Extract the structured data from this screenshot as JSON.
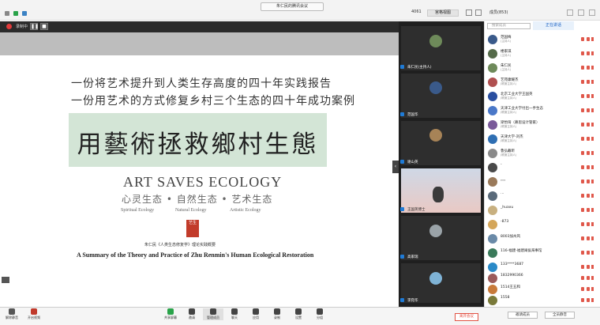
{
  "topbar": {
    "meeting_title": "朱仁民的腾讯会议",
    "meeting_id": "4061",
    "view_mode": "宫格视图",
    "member_panel_label": "成员(853)"
  },
  "recording": {
    "label": "录制中"
  },
  "slide": {
    "line1": "一份将艺术提升到人类生存高度的四十年实践报告",
    "line2": "一份用艺术的方式修复乡村三个生态的四十年成功案例",
    "title_cn": "用藝術拯救鄉村生態",
    "title_en": "ART SAVES ECOLOGY",
    "ecologies_cn": "心灵生态 • 自然生态 • 艺术生态",
    "ecologies_en": [
      "Spiritual Ecology",
      "Natural Ecology",
      "Artistic Ecology"
    ],
    "seal_text": "艺生",
    "citation": "朱仁民《人类生态修复学》理论实践概要",
    "summary_en": "A Summary of the Theory and Practice of  Zhu Renmin's Human Ecological Restoration"
  },
  "video_tiles": [
    {
      "name": "朱仁民(主持人)"
    },
    {
      "name": "范国华"
    },
    {
      "name": "谢山英"
    },
    {
      "name": "王国英博士"
    },
    {
      "name": "高家瑞"
    },
    {
      "name": "李宛华"
    }
  ],
  "participants_panel": {
    "search_placeholder": "搜索成员",
    "speaking_label": "正在讲话",
    "members": [
      {
        "name": "范国梅",
        "role": "(主持人)"
      },
      {
        "name": "楼家琪",
        "role": "(主持人)"
      },
      {
        "name": "朱仁民",
        "role": "(主持人)"
      },
      {
        "name": "艺苑康耀杰",
        "role": "(联席主持人)"
      },
      {
        "name": "北京工业大学王国英",
        "role": "(联席主持人)"
      },
      {
        "name": "天津工业大学付出一手生态",
        "role": "(联席主持人)"
      },
      {
        "name": "梁怡琦（慕思设计管家）",
        "role": "(联席主持人)"
      },
      {
        "name": "天津大学-刘杰",
        "role": "(联席主持人)"
      },
      {
        "name": "鲁弘戴昕",
        "role": "(联席主持人)"
      },
      {
        "name": "-",
        "role": ""
      },
      {
        "name": "。。。",
        "role": ""
      },
      {
        "name": "…",
        "role": ""
      },
      {
        "name": "_huaxu",
        "role": ""
      },
      {
        "name": "-873",
        "role": ""
      },
      {
        "name": "8003加州风",
        "role": ""
      },
      {
        "name": "116-福建-福建闽侯海事馆",
        "role": ""
      },
      {
        "name": "133****3687",
        "role": ""
      },
      {
        "name": "1832990366",
        "role": ""
      },
      {
        "name": "1514王五和",
        "role": ""
      },
      {
        "name": "1558",
        "role": ""
      }
    ],
    "invite_label": "邀请成员",
    "mute_all_label": "全员静音"
  },
  "bottom_toolbar": {
    "items": [
      {
        "label": "解除静音",
        "icon": "mic-icon"
      },
      {
        "label": "开启视频",
        "icon": "camera-icon"
      },
      {
        "label": "共享屏幕",
        "icon": "share-screen-icon"
      },
      {
        "label": "邀请",
        "icon": "invite-icon"
      },
      {
        "label": "管理成员",
        "icon": "members-icon"
      },
      {
        "label": "聊天",
        "icon": "chat-icon"
      },
      {
        "label": "应用",
        "icon": "apps-icon"
      },
      {
        "label": "录制",
        "icon": "record-icon"
      },
      {
        "label": "设置",
        "icon": "settings-icon"
      },
      {
        "label": "分组",
        "icon": "grid-icon"
      }
    ],
    "end_label": "离开会议"
  },
  "colors": {
    "accent_blue": "#1a61c4",
    "end_red": "#e25244",
    "slide_title_bg": "#d3e5d6",
    "seal_red": "#c23b2a"
  }
}
